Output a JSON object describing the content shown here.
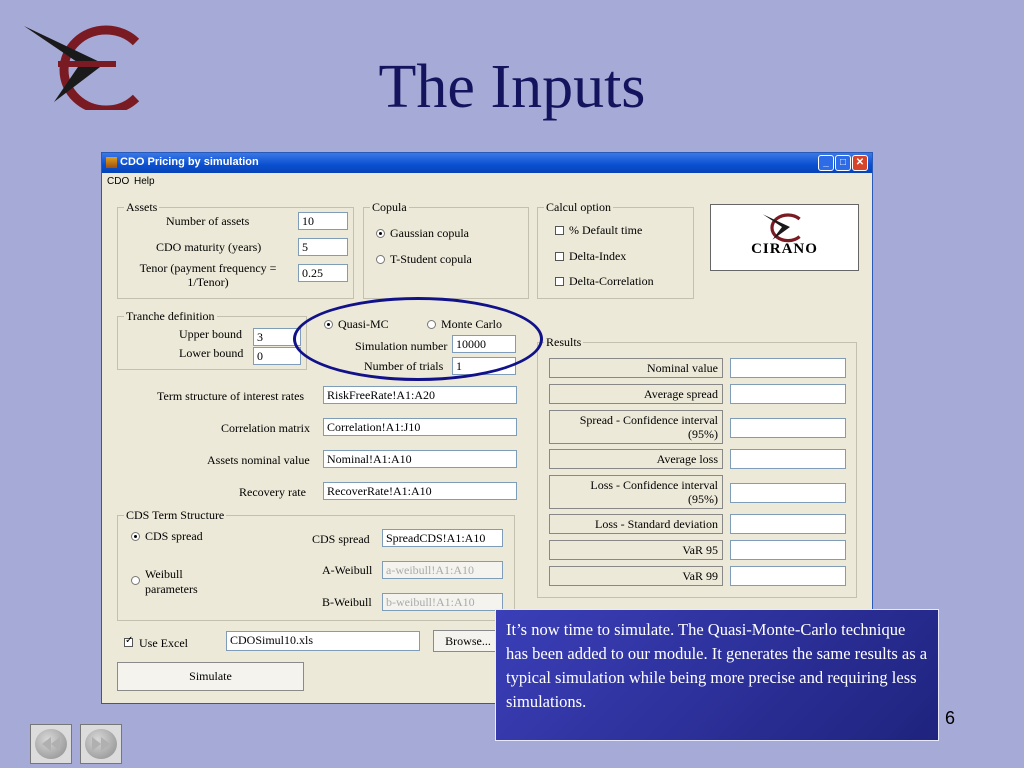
{
  "slide": {
    "title": "The Inputs",
    "page_number": "6",
    "note": "It’s now time to simulate. The Quasi-Monte-Carlo technique has been added to our module. It generates the same results as a typical simulation while being more precise and requiring less simulations."
  },
  "window": {
    "title": "CDO Pricing by simulation",
    "menu": [
      "CDO",
      "Help"
    ],
    "logo_text": "CIRANO",
    "assets": {
      "legend": "Assets",
      "n_assets_label": "Number of assets",
      "n_assets_value": "10",
      "maturity_label": "CDO maturity (years)",
      "maturity_value": "5",
      "tenor_label": "Tenor (payment frequency = 1/Tenor)",
      "tenor_value": "0.25"
    },
    "copula": {
      "legend": "Copula",
      "gaussian": "Gaussian copula",
      "student": "T-Student copula",
      "selected": "gaussian"
    },
    "calcul": {
      "legend": "Calcul option",
      "options": [
        "% Default time",
        "Delta-Index",
        "Delta-Correlation"
      ]
    },
    "tranche": {
      "legend": "Tranche definition",
      "upper_label": "Upper bound",
      "upper_value": "3",
      "lower_label": "Lower bound",
      "lower_value": "0"
    },
    "method": {
      "qmc": "Quasi-MC",
      "mc": "Monte Carlo",
      "selected": "qmc",
      "sim_number_label": "Simulation number",
      "sim_number_value": "10000",
      "trials_label": "Number of trials",
      "trials_value": "1"
    },
    "inputs": [
      {
        "label": "Term structure of interest rates",
        "value": "RiskFreeRate!A1:A20"
      },
      {
        "label": "Correlation matrix",
        "value": "Correlation!A1:J10"
      },
      {
        "label": "Assets nominal value",
        "value": "Nominal!A1:A10"
      },
      {
        "label": "Recovery rate",
        "value": "RecoverRate!A1:A10"
      }
    ],
    "cds": {
      "legend": "CDS Term Structure",
      "spread_option": "CDS spread",
      "weibull_option": "Weibull parameters",
      "spread_label": "CDS spread",
      "spread_value": "SpreadCDS!A1:A10",
      "a_label": "A-Weibull",
      "a_value": "a-weibull!A1:A10",
      "b_label": "B-Weibull",
      "b_value": "b-weibull!A1:A10"
    },
    "use_excel_label": "Use Excel",
    "excel_file": "CDOSimul10.xls",
    "browse_label": "Browse...",
    "simulate_label": "Simulate",
    "results": {
      "legend": "Results",
      "rows": [
        "Nominal value",
        "Average spread",
        "Spread - Confidence interval (95%)",
        "Average loss",
        "Loss - Confidence interval (95%)",
        "Loss - Standard deviation",
        "VaR 95",
        "VaR 99"
      ]
    }
  },
  "colors": {
    "background": "#a6aad6",
    "title": "#14145e",
    "note_bg": "#2b2f9a",
    "highlight_oval": "#11118a"
  }
}
